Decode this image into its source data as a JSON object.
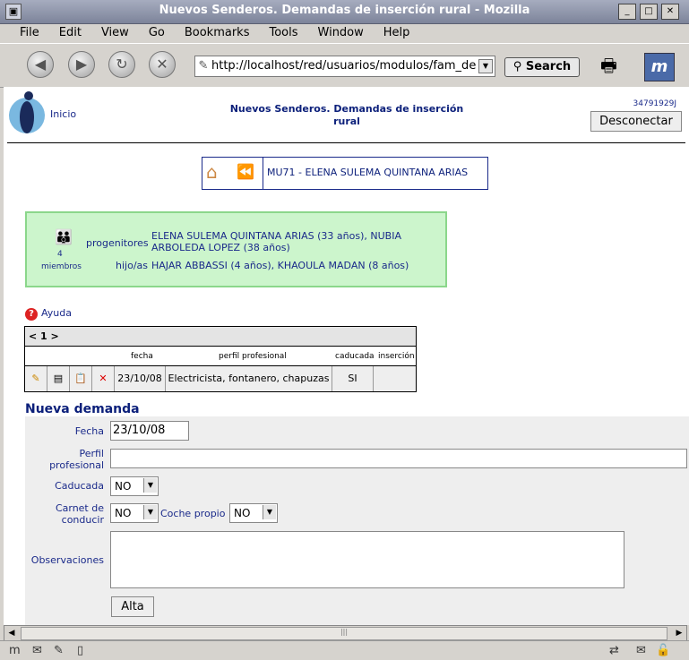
{
  "window": {
    "title": "Nuevos Senderos. Demandas de inserción rural - Mozilla"
  },
  "menu": [
    "File",
    "Edit",
    "View",
    "Go",
    "Bookmarks",
    "Tools",
    "Window",
    "Help"
  ],
  "toolbar": {
    "url": "http://localhost/red/usuarios/modulos/fam_de",
    "search_label": "Search"
  },
  "header": {
    "inicio": "Inicio",
    "title": "Nuevos Senderos. Demandas de inserción rural",
    "user_id": "34791929J",
    "logout_label": "Desconectar"
  },
  "family": {
    "code_name": "MU71 - ELENA SULEMA QUINTANA ARIAS",
    "member_count": "4",
    "members_label": "miembros",
    "parents_label": "progenitores",
    "parents": "ELENA SULEMA QUINTANA ARIAS (33 años), NUBIA ARBOLEDA LOPEZ (38 años)",
    "children_label": "hijo/as",
    "children": "HAJAR ABBASSI (4 años), KHAOULA MADAN (8 años)"
  },
  "help": {
    "label": "Ayuda"
  },
  "table": {
    "pager": "< 1 >",
    "columns": [
      "fecha",
      "perfil profesional",
      "caducada",
      "inserción"
    ],
    "rows": [
      {
        "fecha": "23/10/08",
        "perfil": "Electricista, fontanero, chapuzas",
        "caducada": "SI",
        "insercion": ""
      }
    ]
  },
  "form": {
    "title": "Nueva demanda",
    "fecha_label": "Fecha",
    "fecha_value": "23/10/08",
    "perfil_label": "Perfil profesional",
    "perfil_value": "",
    "caducada_label": "Caducada",
    "caducada_value": "NO",
    "carnet_label": "Carnet de conducir",
    "carnet_value": "NO",
    "coche_label": "Coche propio",
    "coche_value": "NO",
    "observaciones_label": "Observaciones",
    "observaciones_value": "",
    "submit_label": "Alta"
  }
}
